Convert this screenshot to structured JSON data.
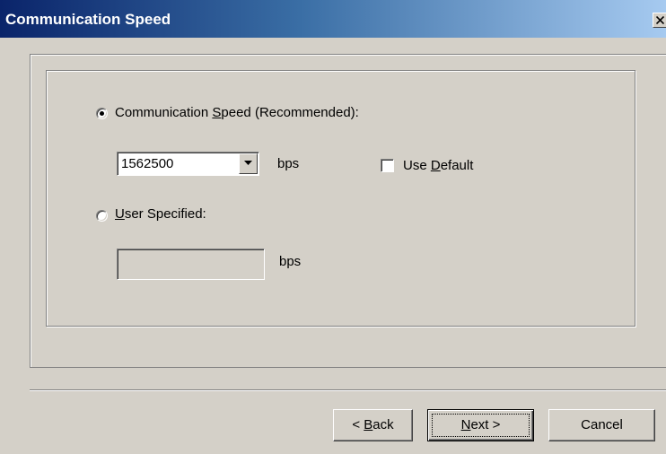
{
  "window": {
    "title": "Communication Speed",
    "close_icon": "close-icon"
  },
  "options": {
    "recommended": {
      "label_pre": "Communication ",
      "label_accel": "S",
      "label_post": "peed (Recommended):",
      "selected": true
    },
    "speed_combo": {
      "value": "1562500",
      "unit": "bps"
    },
    "use_default": {
      "label_pre": "Use ",
      "label_accel": "D",
      "label_post": "efault",
      "checked": false
    },
    "user_specified": {
      "label_pre": "",
      "label_accel": "U",
      "label_post": "ser Specified:",
      "selected": false
    },
    "user_speed": {
      "value": "",
      "unit": "bps"
    }
  },
  "buttons": {
    "back": {
      "pre": "< ",
      "accel": "B",
      "post": "ack"
    },
    "next": {
      "pre": "",
      "accel": "N",
      "post": "ext >"
    },
    "cancel": {
      "label": "Cancel"
    }
  }
}
